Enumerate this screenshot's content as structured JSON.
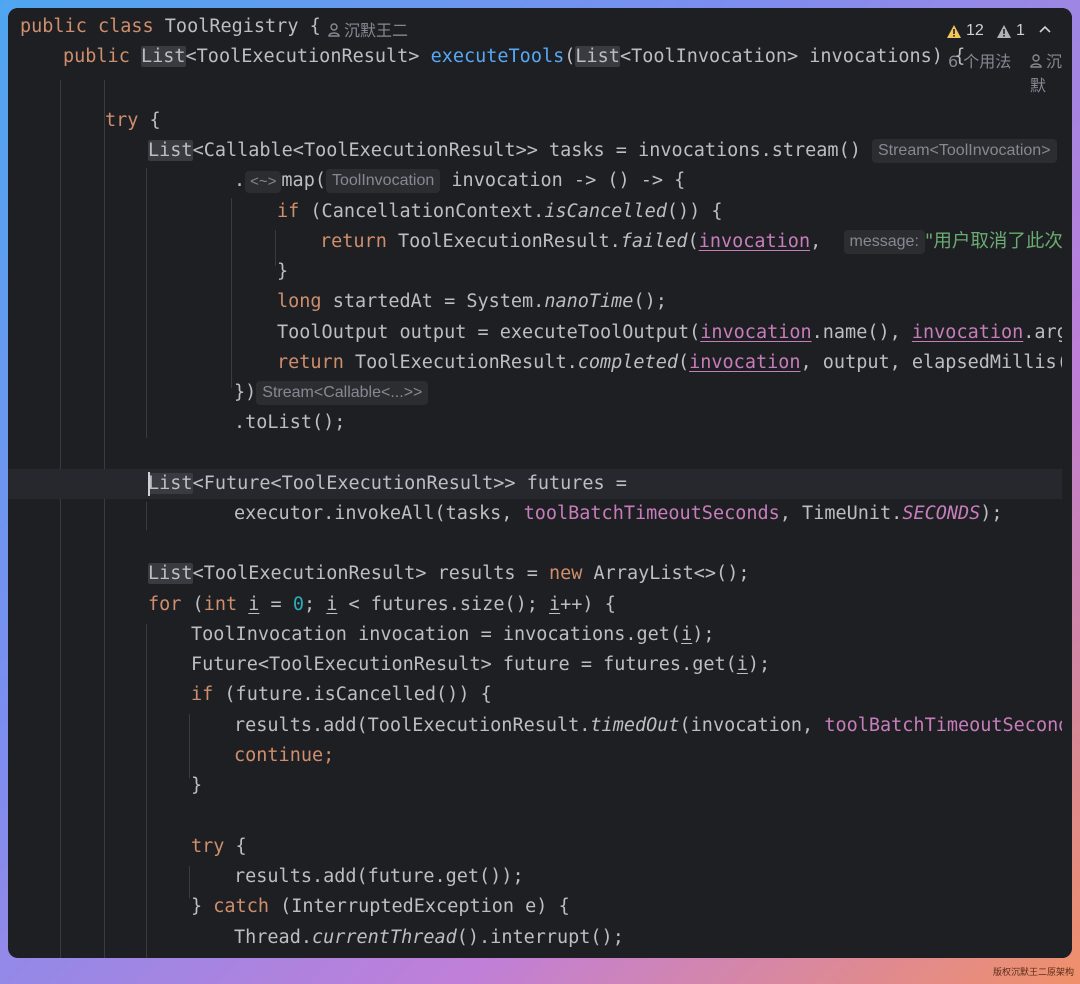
{
  "header": {
    "line1": {
      "kw": "public class ",
      "name": "ToolRegistry",
      "rest": " {"
    },
    "author": "沉默王二",
    "warnings_count": "12",
    "weak_warnings_count": "1",
    "line2": {
      "kw": "public ",
      "type_hl": "List",
      "t1": "<ToolExecutionResult> ",
      "fn": "executeTools",
      "p1": "(",
      "type_hl2": "List",
      "t2": "<ToolInvocation> invocations) {"
    },
    "usages": "6 个用法",
    "author2": "沉默"
  },
  "code": {
    "try": "try",
    "brace_open": " {",
    "l_tasks": {
      "hl": "List",
      "rest": "<Callable<ToolExecutionResult>> tasks = invocations.stream()",
      "hint": "Stream<ToolInvocation>"
    },
    "l_map": {
      "dot": ".",
      "hint_small": "<~>",
      "map": "map(",
      "hint": "ToolInvocation",
      "rest": " invocation -> () -> {"
    },
    "l_if": {
      "kw": "if",
      "rest1": " (CancellationContext.",
      "it": "isCancelled",
      "rest2": "()) {"
    },
    "l_return_failed": {
      "kw": "return",
      "rest1": " ToolExecutionResult.",
      "it": "failed",
      "p": "(",
      "param": "invocation",
      "comma": ", ",
      "hint": "message:",
      "str": "\"用户取消了此次工具"
    },
    "close_brace": "}",
    "l_long": {
      "kw": "long",
      "rest1": " startedAt = System.",
      "it": "nanoTime",
      "rest2": "();"
    },
    "l_output": {
      "rest1": "ToolOutput output = executeToolOutput(",
      "p1": "invocation",
      "rest2": ".name(), ",
      "p2": "invocation",
      "rest3": ".argume"
    },
    "l_return_completed": {
      "kw": "return",
      "rest1": " ToolExecutionResult.",
      "it": "completed",
      "p": "(",
      "param": "invocation",
      "rest2": ", output, elapsedMillis(sta"
    },
    "l_close_map": {
      "text": "})",
      "hint": "Stream<Callable<...>>"
    },
    "l_tolist": ".toList();",
    "l_futures": {
      "hl": "List",
      "rest": "<Future<ToolExecutionResult>> futures ="
    },
    "l_invoke": {
      "rest1": "executor.invokeAll(tasks, ",
      "fld": "toolBatchTimeoutSeconds",
      "rest2": ", TimeUnit.",
      "const": "SECONDS",
      "rest3": ");"
    },
    "l_results": {
      "hl": "List",
      "rest1": "<ToolExecutionResult> results = ",
      "kw": "new",
      "rest2": " ArrayList<>();"
    },
    "l_for": {
      "kw1": "for",
      "p1": " (",
      "kw2": "int",
      "sp": " ",
      "i1": "i",
      "eq": " = ",
      "num": "0",
      "mid": "; ",
      "i2": "i",
      "cond": " < futures.size(); ",
      "i3": "i",
      "end": "++) {"
    },
    "l_inv": {
      "rest": "ToolInvocation invocation = invocations.get(",
      "i": "i",
      "end": ");"
    },
    "l_future": {
      "rest": "Future<ToolExecutionResult> future = futures.get(",
      "i": "i",
      "end": ");"
    },
    "l_if2": {
      "kw": "if",
      "rest": " (future.isCancelled()) {"
    },
    "l_timedout": {
      "rest1": "results.add(ToolExecutionResult.",
      "it": "timedOut",
      "rest2": "(invocation, ",
      "fld": "toolBatchTimeoutSeconds",
      "rest3": "));"
    },
    "l_continue": "continue;",
    "l_try2": {
      "kw": "try",
      "rest": " {"
    },
    "l_add": "results.add(future.get());",
    "l_catch": {
      "b": "} ",
      "kw": "catch",
      "rest": " (InterruptedException e) {"
    },
    "l_thread": {
      "rest1": "Thread.",
      "it": "currentThread",
      "rest2": "().interrupt();"
    }
  },
  "watermark": "版权沉默王二原架构",
  "colors": {
    "background": "#1e1f22",
    "keyword": "#cf8e6d",
    "function": "#56a8f5",
    "field": "#c77dbb",
    "string": "#6aab73",
    "number": "#2aacb8",
    "text": "#bcbec4"
  }
}
